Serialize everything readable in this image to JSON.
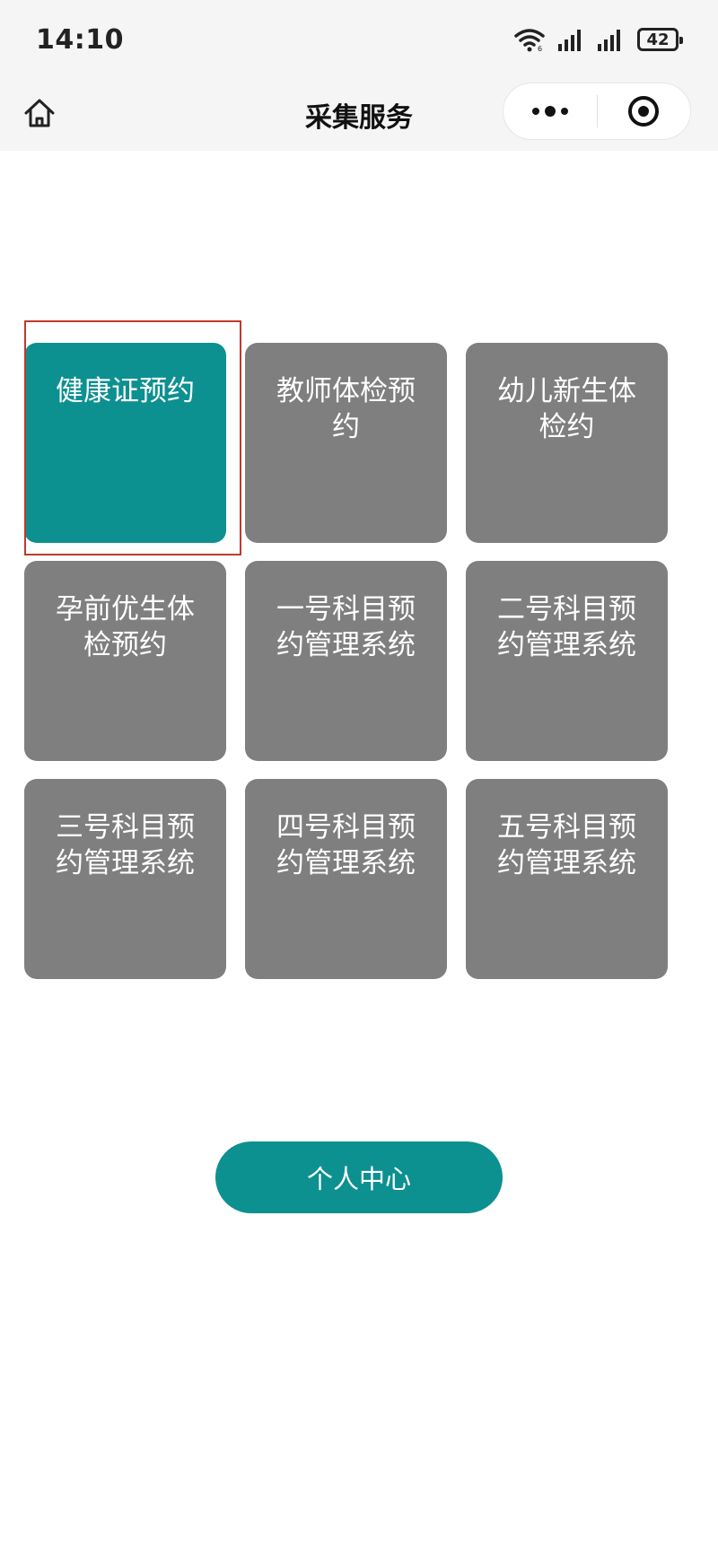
{
  "status_bar": {
    "time": "14:10",
    "battery": "42",
    "icons": [
      "wifi-icon",
      "signal-icon",
      "signal-icon",
      "battery-icon"
    ]
  },
  "nav": {
    "title": "采集服务",
    "home_icon": "home-icon",
    "more_icon": "more-dots-icon",
    "close_icon": "target-close-icon"
  },
  "services": [
    {
      "label": "健康证预约",
      "active": true
    },
    {
      "label": "教师体检预约",
      "active": false
    },
    {
      "label": "幼儿新生体检约",
      "active": false
    },
    {
      "label": "孕前优生体检预约",
      "active": false
    },
    {
      "label": "一号科目预约管理系统",
      "active": false
    },
    {
      "label": "二号科目预约管理系统",
      "active": false
    },
    {
      "label": "三号科目预约管理系统",
      "active": false
    },
    {
      "label": "四号科目预约管理系统",
      "active": false
    },
    {
      "label": "五号科目预约管理系统",
      "active": false
    }
  ],
  "personal_center": {
    "label": "个人中心"
  },
  "colors": {
    "accent": "#0d9090",
    "tile": "#7f7f7f",
    "highlight_frame": "#c0392b",
    "background": "#ffffff",
    "header_bg": "#f5f5f5"
  }
}
